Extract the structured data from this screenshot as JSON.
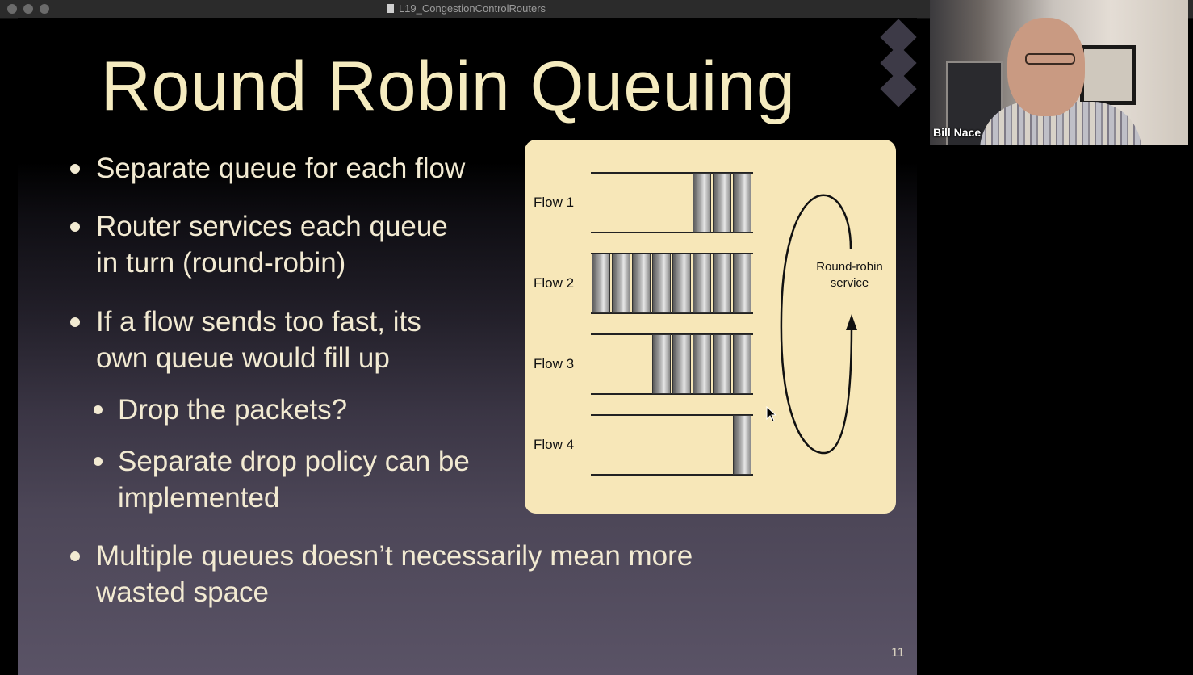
{
  "window": {
    "title": "L19_CongestionControlRouters"
  },
  "slide": {
    "title": "Round Robin Queuing",
    "page_number": "11",
    "bullets": [
      {
        "line1": "Separate queue for each flow",
        "line2": ""
      },
      {
        "line1": "Router services each queue",
        "line2": "in turn (round-robin)"
      },
      {
        "line1": "If a flow sends too fast, its",
        "line2": "own queue would fill up"
      },
      {
        "line1": "Drop the packets?",
        "line2": ""
      },
      {
        "line1": "Separate drop policy can be",
        "line2": "implemented"
      },
      {
        "line1": "Multiple queues doesn’t necessarily mean more",
        "line2": "wasted space"
      }
    ],
    "diagram": {
      "flows": [
        {
          "label": "Flow 1",
          "packets": 3
        },
        {
          "label": "Flow 2",
          "packets": 8
        },
        {
          "label": "Flow 3",
          "packets": 5
        },
        {
          "label": "Flow 4",
          "packets": 1
        }
      ],
      "service_label_line1": "Round-robin",
      "service_label_line2": "service"
    }
  },
  "video": {
    "participant_name": "Bill Nace"
  },
  "colors": {
    "title_text": "#f5ebbf",
    "body_text": "#f2ead2",
    "diagram_bg": "#f7e7b8"
  }
}
